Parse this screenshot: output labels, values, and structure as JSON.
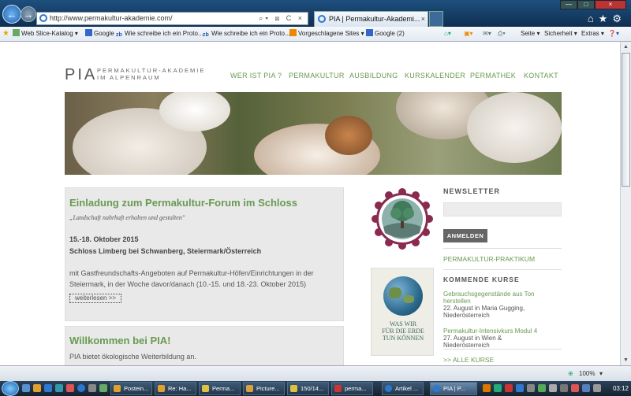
{
  "browser": {
    "url": "http://www.permakultur-akademie.com/",
    "tab_title": "PIA | Permakultur-Akademi...",
    "tab_close": "×",
    "address_tools": "⌕▾ ⊠ C ×",
    "right_tools": "⌂★⚙",
    "win_min": "—",
    "win_max": "□",
    "win_close": "×"
  },
  "favorites": {
    "items": [
      "Web Slice-Katalog ▾",
      "Google",
      "Wie schreibe ich ein Proto...",
      "Wie schreibe ich ein Proto...",
      "Vorgeschlagene Sites ▾",
      "Google (2)"
    ],
    "commands": [
      "Seite ▾",
      "Sicherheit ▾",
      "Extras ▾",
      "❓▾"
    ]
  },
  "site": {
    "logo": "PIA",
    "logo_sub": "PERMAKULTUR-AKADEMIE IM ALPENRAUM",
    "menu": [
      "WER IST PIA ?",
      "PERMAKULTUR",
      "AUSBILDUNG",
      "KURSKALENDER",
      "PERMATHEK",
      "KONTAKT"
    ]
  },
  "post": {
    "title": "Einladung zum Permakultur-Forum im Schloss",
    "quote": "„Landschaft nahrhaft erhalten und gestalten\"",
    "date": "15.-18. Oktober 2015",
    "location": "Schloss Limberg bei Schwanberg, Steiermark/Österreich",
    "body": "mit Gastfreundschafts-Angeboten auf Permakultur-Höfen/Einrichtungen in der Steiermark, in der Woche davor/danach (10.-15. und 18.-23. Oktober 2015)",
    "more": "weiterlesen >>"
  },
  "welcome": {
    "title": "Willkommen bei PIA!",
    "body": "PIA bietet ökologische Weiterbildung an."
  },
  "sidebar": {
    "book_lines": [
      "WAS WIR",
      "FÜR DIE ERDE",
      "TUN KÖNNEN"
    ],
    "newsletter_title": "NEWSLETTER",
    "newsletter_button": "ANMELDEN",
    "praktikum_link": "PERMAKULTUR-PRAKTIKUM",
    "courses_title": "KOMMENDE KURSE",
    "courses": [
      {
        "title": "Gebrauchsgegenstände aus Ton herstellen",
        "date": "22. August in Maria Gugging, Niederösterreich"
      },
      {
        "title": "Permakultur-Intensivkurs Modul 4",
        "date": "27. August in Wien & Niederösterreich"
      }
    ],
    "all_courses": ">> ALLE KURSE"
  },
  "status": {
    "zoom": "100%"
  },
  "taskbar": {
    "items": [
      "Postein...",
      "Re: Ha...",
      "Perma...",
      "Picture...",
      "150/14...",
      "perma...",
      "Artikel ...",
      "PIA | P..."
    ],
    "clock": "03:12"
  },
  "colors": {
    "accent": "#6a9a52",
    "badge": "#8a2a4e",
    "titlebar": "#1e4f7e"
  }
}
